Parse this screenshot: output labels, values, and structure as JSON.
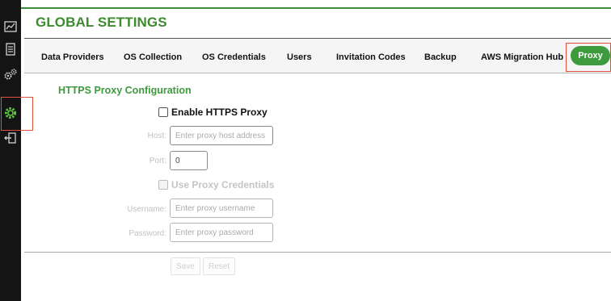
{
  "page": {
    "title": "GLOBAL SETTINGS"
  },
  "sidebar": {
    "items": [
      {
        "icon": "chart-icon"
      },
      {
        "icon": "document-icon"
      },
      {
        "icon": "gears-icon"
      },
      {
        "icon": "settings-gear-icon",
        "active": true
      },
      {
        "icon": "logout-icon"
      }
    ]
  },
  "tabs": [
    {
      "label": "Data Providers"
    },
    {
      "label": "OS Collection"
    },
    {
      "label": "OS Credentials"
    },
    {
      "label": "Users"
    },
    {
      "label": "Invitation Codes"
    },
    {
      "label": "Backup"
    },
    {
      "label": "AWS Migration Hub"
    },
    {
      "label": "Proxy",
      "active": true
    }
  ],
  "proxy": {
    "section_title": "HTTPS Proxy Configuration",
    "enable_label": "Enable HTTPS Proxy",
    "host_label": "Host:",
    "host_placeholder": "Enter proxy host address",
    "port_label": "Port:",
    "port_value": "0",
    "use_credentials_label": "Use Proxy Credentials",
    "username_label": "Username:",
    "username_placeholder": "Enter proxy username",
    "password_label": "Password:",
    "password_placeholder": "Enter proxy password",
    "save_label": "Save",
    "reset_label": "Reset"
  },
  "colors": {
    "accent": "#3d9a3d",
    "highlight": "#e0503c",
    "rail": "#141414"
  }
}
